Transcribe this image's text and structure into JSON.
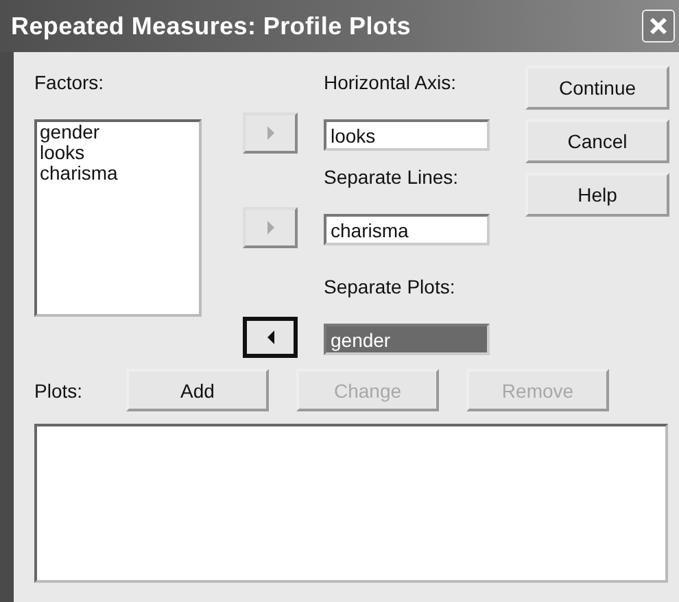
{
  "window": {
    "title": "Repeated Measures: Profile Plots"
  },
  "factors": {
    "label": "Factors:",
    "items": [
      "gender",
      "looks",
      "charisma"
    ]
  },
  "targets": [
    {
      "label": "Horizontal Axis:",
      "value": "looks",
      "selected": false,
      "kind": "right",
      "disabled": true
    },
    {
      "label": "Separate Lines:",
      "value": "charisma",
      "selected": false,
      "kind": "right",
      "disabled": true
    },
    {
      "label": "Separate Plots:",
      "value": "gender",
      "selected": true,
      "kind": "left",
      "disabled": false
    }
  ],
  "buttons": [
    "Continue",
    "Cancel",
    "Help"
  ],
  "plots": {
    "label": "Plots:",
    "buttons": [
      {
        "label": "Add",
        "disabled": false
      },
      {
        "label": "Change",
        "disabled": true
      },
      {
        "label": "Remove",
        "disabled": true
      }
    ]
  }
}
